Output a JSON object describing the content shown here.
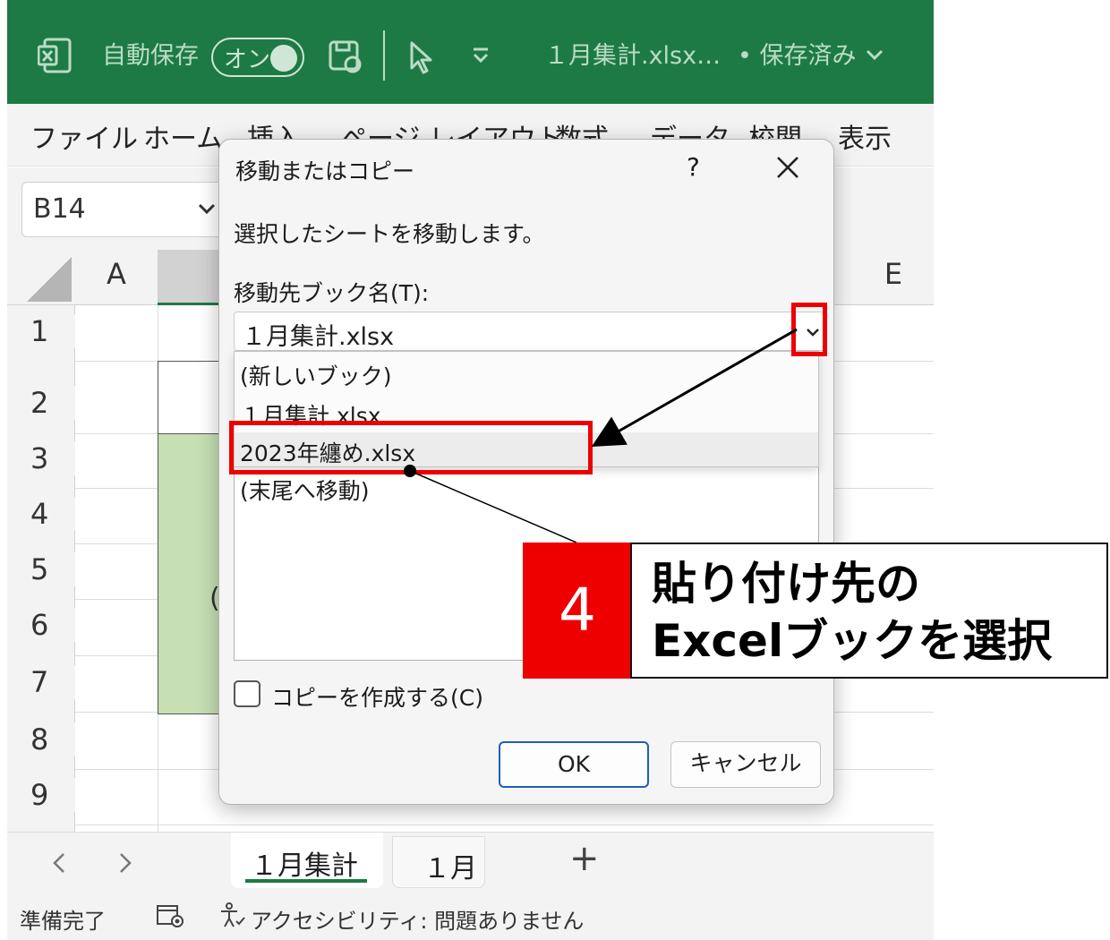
{
  "titlebar": {
    "autosave_label": "自動保存",
    "autosave_state": "オン",
    "file_title": "１月集計.xlsx…",
    "save_status": "• 保存済み"
  },
  "ribbon": {
    "tabs": [
      "ファイル",
      "ホーム",
      "挿入",
      "ページ レイアウト",
      "数式",
      "データ",
      "校閲",
      "表示"
    ]
  },
  "formula_bar": {
    "namebox": "B14"
  },
  "grid": {
    "columns": [
      "A",
      "E"
    ],
    "rows": [
      "1",
      "2",
      "3",
      "4",
      "5",
      "6",
      "7",
      "8",
      "9"
    ],
    "cell_fragment": "("
  },
  "sheet_tabs": {
    "tabs": [
      "１月集計",
      "１月"
    ],
    "add": "+"
  },
  "status_bar": {
    "ready": "準備完了",
    "accessibility": "アクセシビリティ: 問題ありません"
  },
  "dialog": {
    "title": "移動またはコピー",
    "help": "?",
    "close": "✕",
    "description": "選択したシートを移動します。",
    "dest_label": "移動先ブック名(T):",
    "dest_value": "１月集計.xlsx",
    "dropdown_options": [
      "(新しいブック)",
      "１月集計.xlsx",
      "2023年纏め.xlsx"
    ],
    "sheet_list_visible_item": "(末尾へ移動)",
    "copy_checkbox_label": "コピーを作成する(C)",
    "copy_checked": false,
    "ok_label": "OK",
    "cancel_label": "キャンセル"
  },
  "annotation": {
    "step_number": "4",
    "text_line1": "貼り付け先の",
    "text_line2": "Excelブックを選択"
  },
  "colors": {
    "titlebar_green": "#1e7a44",
    "highlight_red": "#ee0000",
    "cell_fill_green": "#c6dfb3"
  }
}
